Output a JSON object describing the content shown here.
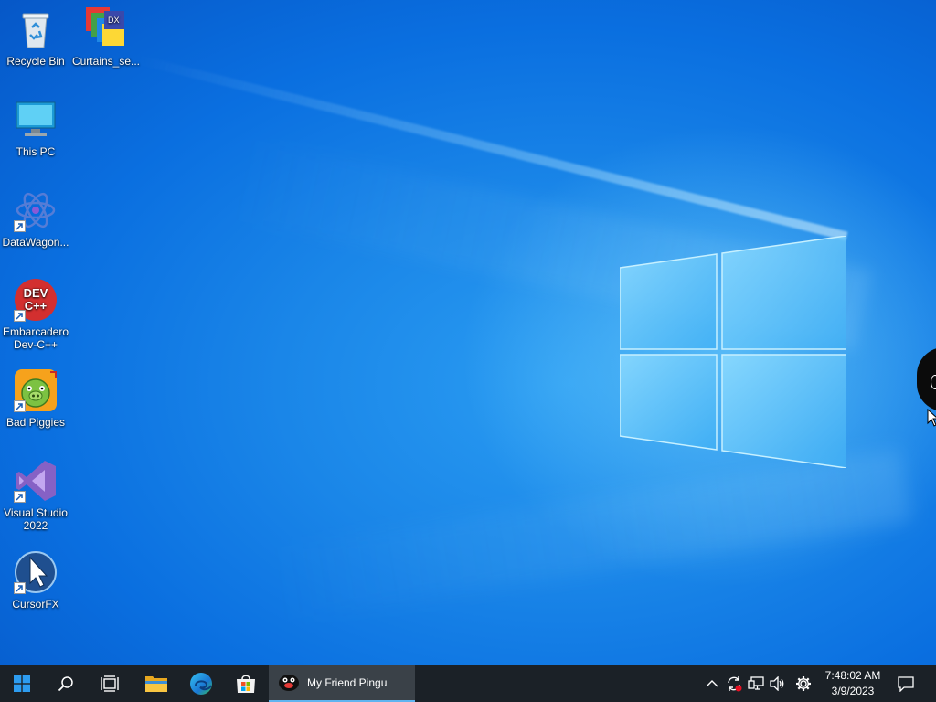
{
  "desktop": {
    "icons": [
      {
        "label": "Recycle Bin",
        "icon": "recycle-bin-icon",
        "shortcut": false
      },
      {
        "label": "Curtains_se...",
        "icon": "curtains-icon",
        "shortcut": false
      },
      {
        "label": "This PC",
        "icon": "this-pc-icon",
        "shortcut": false
      },
      {
        "label": "DataWagon...",
        "icon": "datawagon-icon",
        "shortcut": true
      },
      {
        "label": "Embarcadero Dev-C++",
        "icon": "devcpp-icon",
        "shortcut": true
      },
      {
        "label": "Bad Piggies",
        "icon": "bad-piggies-icon",
        "shortcut": true
      },
      {
        "label": "Visual Studio 2022",
        "icon": "visual-studio-icon",
        "shortcut": true
      },
      {
        "label": "CursorFX",
        "icon": "cursorfx-icon",
        "shortcut": true
      }
    ],
    "devcpp_logo_text_1": "DEV",
    "devcpp_logo_text_2": "C++",
    "curtains_logo_text": "DX"
  },
  "taskbar": {
    "start": "windows-start-icon",
    "search": "search-icon",
    "task_view": "task-view-icon",
    "pinned": [
      "file-explorer-icon",
      "edge-icon",
      "microsoft-store-icon"
    ],
    "running_app": {
      "label": "My Friend Pingu",
      "icon": "pingu-icon"
    },
    "tray": {
      "icons": [
        "chevron-up-icon",
        "update-icon",
        "network-icon",
        "volume-icon",
        "settings-gear-icon"
      ],
      "time": "7:48:02 AM",
      "date": "3/9/2023",
      "notifications": "notification-icon"
    }
  },
  "colors": {
    "wallpaper": "#0a6fe0",
    "taskbar": "#1b2127",
    "active_app": "#3a4148",
    "accent": "#5fb4f0"
  }
}
